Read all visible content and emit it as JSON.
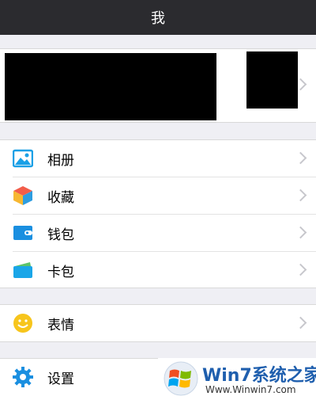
{
  "navbar": {
    "title": "我"
  },
  "menu": {
    "album": "相册",
    "favorites": "收藏",
    "wallet": "钱包",
    "card_wallet": "卡包",
    "stickers": "表情",
    "settings": "设置"
  },
  "watermark": {
    "brand": "Win7系统之家",
    "url": "Www.Winwin7.com"
  }
}
